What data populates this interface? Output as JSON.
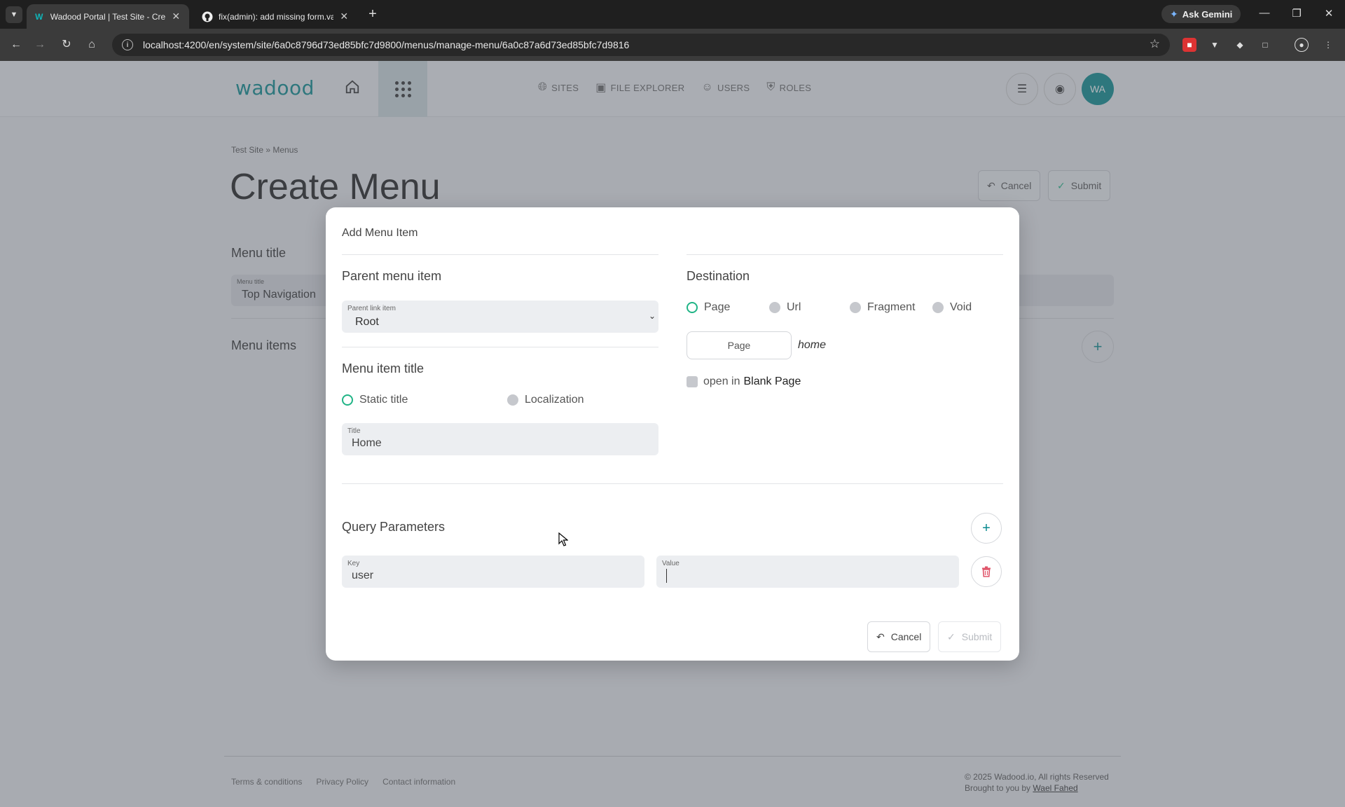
{
  "browser": {
    "tabs": [
      {
        "title": "Wadood Portal | Test Site - Create Menu",
        "active": true
      },
      {
        "title": "fix(admin): add missing form.valid",
        "active": false
      }
    ],
    "url": "localhost:4200/en/system/site/6a0c8796d73ed85bfc7d9800/menus/manage-menu/6a0c87a6d73ed85bfc7d9816",
    "gemini_label": "Ask Gemini"
  },
  "header": {
    "logo": "wadood",
    "nav": [
      {
        "label": "SITES",
        "icon": "globe-icon"
      },
      {
        "label": "FILE EXPLORER",
        "icon": "images-icon"
      },
      {
        "label": "USERS",
        "icon": "users-icon"
      },
      {
        "label": "ROLES",
        "icon": "shield-icon"
      }
    ],
    "avatar_initials": "WA"
  },
  "page": {
    "breadcrumb": "Test Site  » Menus",
    "title": "Create Menu",
    "cancel_label": "Cancel",
    "submit_label": "Submit",
    "menu_title_heading": "Menu title",
    "menu_title_field_label": "Menu title",
    "menu_title_value": "Top Navigation",
    "menu_items_heading": "Menu items"
  },
  "modal": {
    "title": "Add Menu Item",
    "parent_heading": "Parent menu item",
    "parent_field_label": "Parent link item",
    "parent_value": "Root",
    "item_title_heading": "Menu item title",
    "title_mode_options": [
      {
        "label": "Static title",
        "selected": true
      },
      {
        "label": "Localization",
        "selected": false
      }
    ],
    "title_field_label": "Title",
    "title_value": "Home",
    "destination_heading": "Destination",
    "destination_options": [
      {
        "label": "Page",
        "selected": true
      },
      {
        "label": "Url",
        "selected": false
      },
      {
        "label": "Fragment",
        "selected": false
      },
      {
        "label": "Void",
        "selected": false
      }
    ],
    "page_button_label": "Page",
    "page_value": "home",
    "open_in_label": "open in",
    "blank_page_label": "Blank Page",
    "open_in_blank_checked": false,
    "query_heading": "Query Parameters",
    "query_params": [
      {
        "key_label": "Key",
        "key": "user",
        "value_label": "Value",
        "value": ""
      }
    ],
    "cancel_label": "Cancel",
    "submit_label": "Submit"
  },
  "footer": {
    "links": [
      "Terms & conditions",
      "Privacy Policy",
      "Contact information"
    ],
    "copyright": "© 2025 Wadood.io, All rights Reserved",
    "brought_by": "Brought to you by",
    "author": "Wael Fahed"
  },
  "colors": {
    "accent": "#0a8a8f",
    "radio_selected": "#20b486",
    "delete": "#e0566b"
  }
}
